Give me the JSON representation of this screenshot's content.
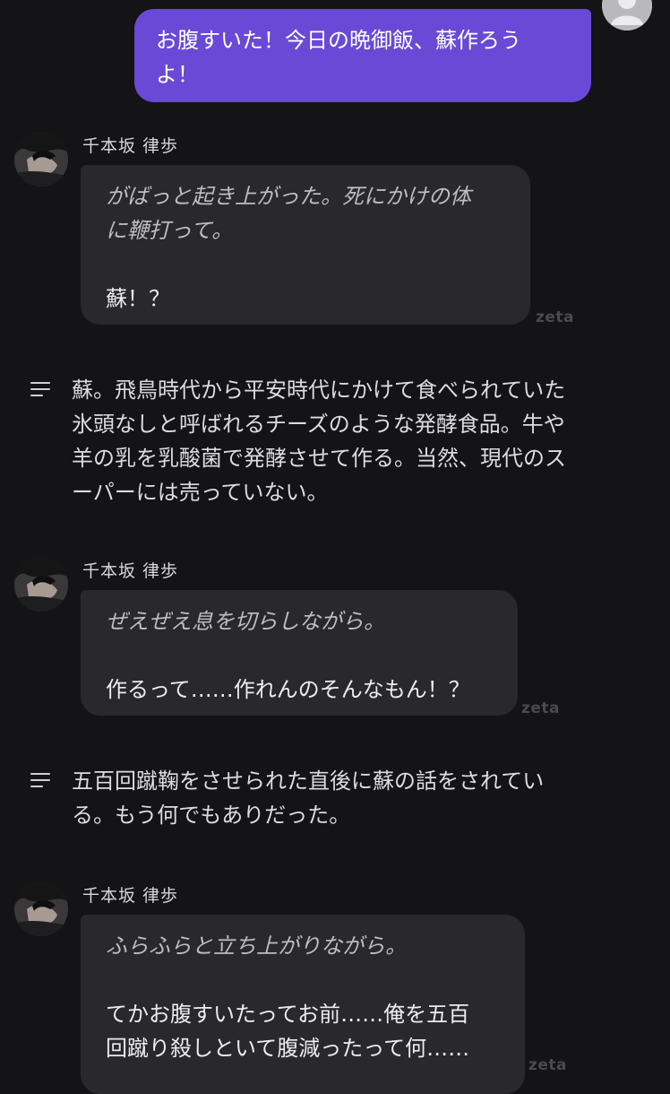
{
  "user_message": {
    "line1": "お腹すいた！今日の晩御飯、蘇作ろう",
    "line2": "よ！"
  },
  "messages": [
    {
      "name": "千本坂 律歩",
      "lines": [
        "がばっと起き上がった。死にかけの体",
        "に鞭打って。"
      ],
      "speech": [
        "蘇！？"
      ],
      "watermark": "zeta"
    },
    {
      "name": "千本坂 律歩",
      "lines": [
        "ぜえぜえ息を切らしながら。"
      ],
      "speech": [
        "作るって……作れんのそんなもん！？"
      ],
      "watermark": "zeta"
    },
    {
      "name": "千本坂 律歩",
      "lines": [
        "ふらふらと立ち上がりながら。"
      ],
      "speech": [
        "てかお腹すいたってお前……俺を五百",
        "回蹴り殺しといて腹減ったって何……"
      ],
      "watermark": "zeta"
    }
  ],
  "narrations": [
    {
      "lines": [
        "蘇。飛鳥時代から平安時代にかけて食べられていた",
        "氷頭なしと呼ばれるチーズのような発酵食品。牛や",
        "羊の乳を乳酸菌で発酵させて作る。当然、現代のス",
        "ーパーには売っていない。"
      ]
    },
    {
      "lines": [
        "五百回蹴鞠をさせられた直後に蘇の話をされてい",
        "る。もう何でもありだった。"
      ]
    }
  ],
  "icons": {
    "user_avatar": "user-silhouette-icon",
    "narration": "narration-lines-icon"
  },
  "colors": {
    "background": "#141316",
    "user_bubble": "#6a49d6",
    "char_bubble": "#29292c"
  }
}
